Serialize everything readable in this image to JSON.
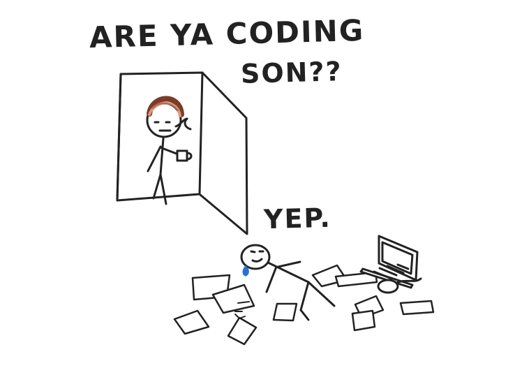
{
  "comic": {
    "caption_line_1": "ARE YA CODING",
    "caption_line_2": "SON??",
    "reply": "YEP."
  },
  "colors": {
    "ink": "#222222",
    "tear": "#2a6fd6",
    "hair_dark": "#7a3c2a",
    "hair_light": "#d89a7c"
  },
  "icons": {
    "door": "door-icon",
    "parent": "parent-stick-figure-icon",
    "mug": "mug-icon",
    "child": "collapsed-stick-figure-icon",
    "laptop": "laptop-icon",
    "mouse": "mouse-icon"
  }
}
